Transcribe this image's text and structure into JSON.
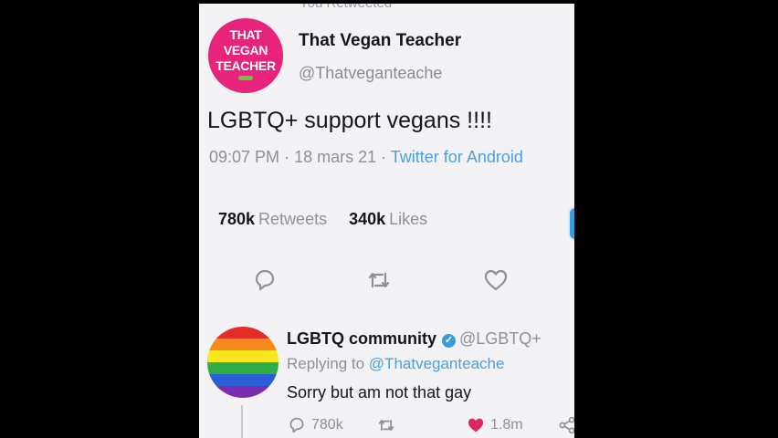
{
  "tweet": {
    "retweeted_note": "You Retweeted",
    "avatar": {
      "line1": "THAT",
      "line2": "VEGAN",
      "line3": "TEACHER"
    },
    "display_name": "That Vegan Teacher",
    "handle": "@Thatveganteache",
    "text": "LGBTQ+ support vegans !!!!",
    "time": "09:07 PM",
    "date": "18 mars 21",
    "source": "Twitter for Android",
    "retweets_count": "780k",
    "retweets_label": "Retweets",
    "likes_count": "340k",
    "likes_label": "Likes"
  },
  "reply": {
    "display_name": "LGBTQ community",
    "handle": "@LGBTQ+",
    "replying_label": "Replying to",
    "replying_to": "@Thatveganteache",
    "text": "Sorry but am not that gay",
    "reply_count": "780k",
    "like_count": "1.8m"
  },
  "colors": {
    "brand_pink": "#e8237a",
    "link_blue": "#4a9fe0",
    "like_red": "#e0245e"
  }
}
